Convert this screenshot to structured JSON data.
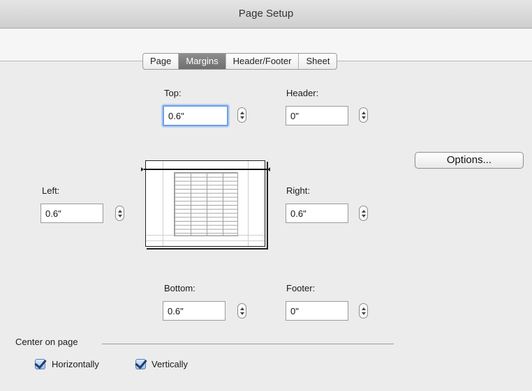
{
  "window": {
    "title": "Page Setup"
  },
  "tabs": [
    {
      "label": "Page",
      "active": false
    },
    {
      "label": "Margins",
      "active": true
    },
    {
      "label": "Header/Footer",
      "active": false
    },
    {
      "label": "Sheet",
      "active": false
    }
  ],
  "margins": {
    "top": {
      "label": "Top:",
      "value": "0.6\""
    },
    "header": {
      "label": "Header:",
      "value": "0\""
    },
    "left": {
      "label": "Left:",
      "value": "0.6\""
    },
    "right": {
      "label": "Right:",
      "value": "0.6\""
    },
    "bottom": {
      "label": "Bottom:",
      "value": "0.6\""
    },
    "footer": {
      "label": "Footer:",
      "value": "0\""
    }
  },
  "options_button": {
    "label": "Options..."
  },
  "center_on_page": {
    "label": "Center on page",
    "horizontally": {
      "label": "Horizontally",
      "checked": true
    },
    "vertically": {
      "label": "Vertically",
      "checked": true
    }
  },
  "colors": {
    "focus_ring": "#6d9fe3",
    "selection": "#e6b2f2",
    "active_tab": "#7a7a7a",
    "checkbox": "#9cc0ee"
  }
}
